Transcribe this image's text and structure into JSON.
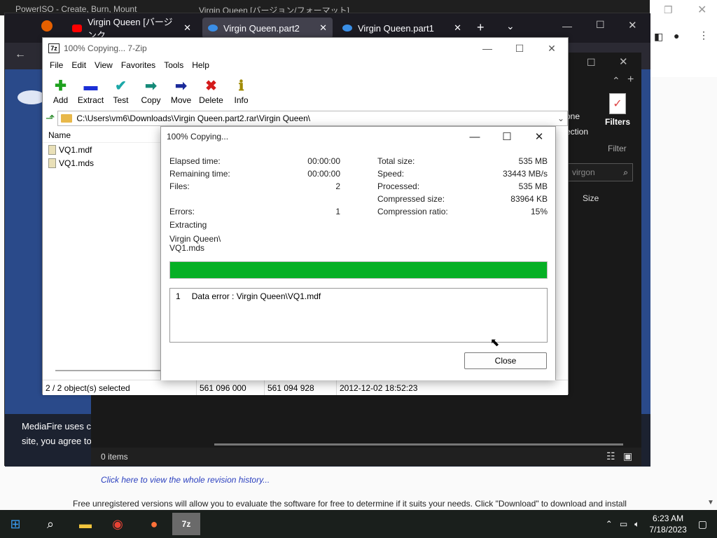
{
  "background_browser": {
    "tabs": [
      "PowerISO - Create, Burn, Mount",
      "Virgin Queen [バージョン/フォーマット]"
    ]
  },
  "firefox": {
    "tabs": [
      {
        "label": "Virgin Queen [バージンク",
        "icon": "youtube-icon"
      },
      {
        "label": "Virgin Queen.part2",
        "icon": "mediafire-icon"
      },
      {
        "label": "Virgin Queen.part1",
        "icon": "mediafire-icon"
      }
    ],
    "cookie_text_1": "MediaFire uses c",
    "cookie_text_2": "site, you agree to"
  },
  "explorer": {
    "ribbon_filters": "Filters",
    "ribbon_filter_group": "Filter",
    "ribbon_partial_1": "one",
    "ribbon_partial_2": "ection",
    "search_value": "virgon",
    "col_size": "Size",
    "status_items": "0 items"
  },
  "zip": {
    "title": "100% Copying... 7-Zip",
    "logo": "7z",
    "menu": [
      "File",
      "Edit",
      "View",
      "Favorites",
      "Tools",
      "Help"
    ],
    "toolbar": [
      {
        "label": "Add",
        "icon": "add-icon",
        "glyph": "✚",
        "color": "#1ea11e"
      },
      {
        "label": "Extract",
        "icon": "extract-icon",
        "glyph": "▬",
        "color": "#1b2fd6"
      },
      {
        "label": "Test",
        "icon": "test-icon",
        "glyph": "✔",
        "color": "#1ca8a8"
      },
      {
        "label": "Copy",
        "icon": "copy-icon",
        "glyph": "➡",
        "color": "#158a78"
      },
      {
        "label": "Move",
        "icon": "move-icon",
        "glyph": "➡",
        "color": "#1a2a9a"
      },
      {
        "label": "Delete",
        "icon": "delete-icon",
        "glyph": "✖",
        "color": "#d41b1b"
      },
      {
        "label": "Info",
        "icon": "info-icon",
        "glyph": "ℹ",
        "color": "#a08a00"
      }
    ],
    "path": "C:\\Users\\vm6\\Downloads\\Virgin Queen.part2.rar\\Virgin Queen\\",
    "col_name": "Name",
    "files": [
      "VQ1.mdf",
      "VQ1.mds"
    ],
    "status": {
      "selected": "2 / 2 object(s) selected",
      "size": "561 096 000",
      "packed": "561 094 928",
      "modified": "2012-12-02 18:52:23"
    }
  },
  "dialog": {
    "title": "100% Copying...",
    "left_labels": [
      "Elapsed time:",
      "Remaining time:",
      "Files:",
      "Errors:"
    ],
    "left_values": [
      "00:00:00",
      "00:00:00",
      "2",
      "1"
    ],
    "right_labels": [
      "Total size:",
      "Speed:",
      "Processed:",
      "Compressed size:",
      "Compression ratio:"
    ],
    "right_values": [
      "535 MB",
      "33443 MB/s",
      "535 MB",
      "83964 KB",
      "15%"
    ],
    "operation": "Extracting",
    "current_file_1": "Virgin Queen\\",
    "current_file_2": "VQ1.mds",
    "progress": 1.0,
    "log": [
      {
        "index": "1",
        "message": "Data error : Virgin Queen\\VQ1.mdf"
      }
    ],
    "close_label": "Close"
  },
  "web": {
    "history_link": "Click here to view the whole revision history...",
    "info_text": "Free unregistered versions will allow you to evaluate the software for free to determine if it suits your needs. Click \"Download\" to download and install"
  },
  "taskbar": {
    "time": "6:23 AM",
    "date": "7/18/2023"
  }
}
